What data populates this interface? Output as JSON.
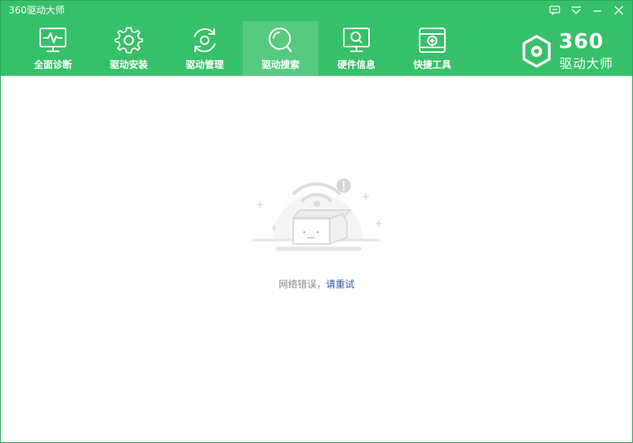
{
  "app": {
    "title": "360驱动大师"
  },
  "nav": {
    "items": [
      {
        "label": "全面诊断",
        "icon": "monitor-pulse-icon"
      },
      {
        "label": "驱动安装",
        "icon": "gear-icon"
      },
      {
        "label": "驱动管理",
        "icon": "refresh-gear-icon"
      },
      {
        "label": "驱动搜索",
        "icon": "search-icon",
        "active": true
      },
      {
        "label": "硬件信息",
        "icon": "monitor-search-icon"
      },
      {
        "label": "快捷工具",
        "icon": "toolbox-icon"
      }
    ]
  },
  "brand": {
    "number": "360",
    "name": "驱动大师",
    "logo": "360-gear-logo-icon"
  },
  "window_controls": {
    "feedback": "chat-icon",
    "menu": "menu-down-icon",
    "minimize": "minimize-icon",
    "close": "close-icon"
  },
  "content": {
    "message_prefix": "网络错误，",
    "retry_label": "请重试",
    "illustration": "no-network-box-icon"
  },
  "colors": {
    "header_green": "#37c06a",
    "border_green": "#2aa65a",
    "link_blue": "#2c5aa0",
    "muted_text": "#888888"
  }
}
